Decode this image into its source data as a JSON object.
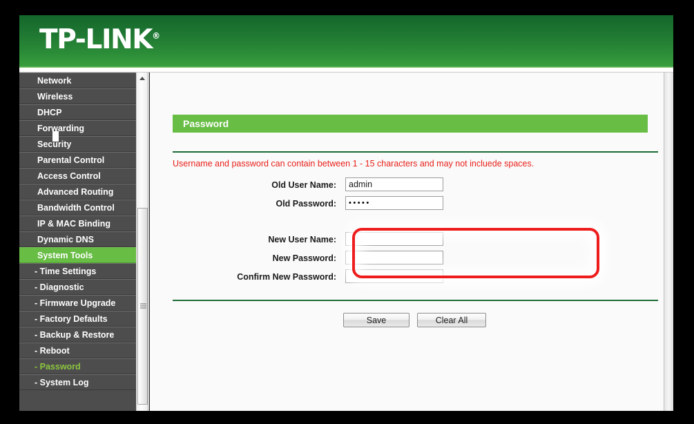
{
  "brand": {
    "logo_text": "TP-LINK",
    "registered_mark": "®"
  },
  "sidebar": {
    "items": [
      {
        "label": "Network",
        "type": "top",
        "state": "normal"
      },
      {
        "label": "Wireless",
        "type": "top",
        "state": "normal"
      },
      {
        "label": "DHCP",
        "type": "top",
        "state": "normal"
      },
      {
        "label": "Forwarding",
        "type": "top",
        "state": "normal"
      },
      {
        "label": "Security",
        "type": "top",
        "state": "normal"
      },
      {
        "label": "Parental Control",
        "type": "top",
        "state": "normal"
      },
      {
        "label": "Access Control",
        "type": "top",
        "state": "normal"
      },
      {
        "label": "Advanced Routing",
        "type": "top",
        "state": "normal"
      },
      {
        "label": "Bandwidth Control",
        "type": "top",
        "state": "normal"
      },
      {
        "label": "IP & MAC Binding",
        "type": "top",
        "state": "normal"
      },
      {
        "label": "Dynamic DNS",
        "type": "top",
        "state": "normal"
      },
      {
        "label": "System Tools",
        "type": "top",
        "state": "active-parent"
      },
      {
        "label": "- Time Settings",
        "type": "sub",
        "state": "normal"
      },
      {
        "label": "- Diagnostic",
        "type": "sub",
        "state": "normal"
      },
      {
        "label": "- Firmware Upgrade",
        "type": "sub",
        "state": "normal"
      },
      {
        "label": "- Factory Defaults",
        "type": "sub",
        "state": "normal"
      },
      {
        "label": "- Backup & Restore",
        "type": "sub",
        "state": "normal"
      },
      {
        "label": "- Reboot",
        "type": "sub",
        "state": "normal"
      },
      {
        "label": "- Password",
        "type": "sub",
        "state": "active-child"
      },
      {
        "label": "- System Log",
        "type": "sub",
        "state": "normal"
      }
    ],
    "scrollbar": {
      "up_arrow_icon": "triangle-up-icon",
      "grip_icon": "grip-lines-icon"
    }
  },
  "content": {
    "page_title": "Password",
    "notice": "Username and password can contain between 1 - 15 characters and may not incluede spaces.",
    "fields": [
      {
        "label": "Old User Name:",
        "value": "admin",
        "type": "text",
        "highlighted": true
      },
      {
        "label": "Old Password:",
        "value": "•••••",
        "type": "password",
        "highlighted": true
      },
      {
        "label": "New User Name:",
        "value": "",
        "type": "text",
        "highlighted": false
      },
      {
        "label": "New Password:",
        "value": "",
        "type": "password",
        "highlighted": false
      },
      {
        "label": "Confirm New Password:",
        "value": "",
        "type": "password",
        "highlighted": false
      }
    ],
    "buttons": {
      "save_label": "Save",
      "clear_label": "Clear All"
    }
  },
  "colors": {
    "brand_green_dark": "#14672b",
    "brand_green_light": "#3a9e3d",
    "accent_green": "#68bd45",
    "active_link_green": "#8cc63f",
    "sidebar_bg": "#4d4d4d",
    "notice_red": "#e8201a",
    "annotation_red": "#ee1c1c",
    "divider_green": "#1a6b34",
    "content_bg": "#fafafa"
  },
  "annotation": {
    "shape": "rounded-rectangle",
    "color": "#ee1c1c",
    "targets": [
      "Old User Name:",
      "Old Password:"
    ]
  }
}
